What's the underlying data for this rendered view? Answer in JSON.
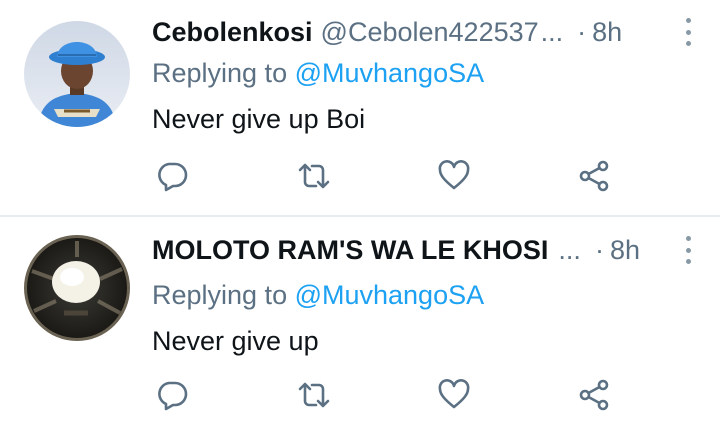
{
  "tweets": [
    {
      "name": "Cebolenkosi",
      "handle": "@Cebolen422537",
      "ellipsis": "...",
      "separator": "·",
      "time": "8h",
      "replying_prefix": "Replying to ",
      "replying_to": "@MuvhangoSA",
      "text": "Never give up Boi"
    },
    {
      "name": "MOLOTO RAM'S WA LE KHOSI",
      "handle": "",
      "ellipsis": "...",
      "separator": "·",
      "time": "8h",
      "replying_prefix": "Replying to ",
      "replying_to": "@MuvhangoSA",
      "text": "Never give up"
    }
  ],
  "icons": {
    "reply": "reply-icon",
    "retweet": "retweet-icon",
    "like": "like-icon",
    "share": "share-icon",
    "more": "more-options-icon"
  },
  "colors": {
    "text": "#0f1419",
    "secondary": "#5b7083",
    "link": "#1da1f2",
    "divider": "#e6ecf0"
  }
}
